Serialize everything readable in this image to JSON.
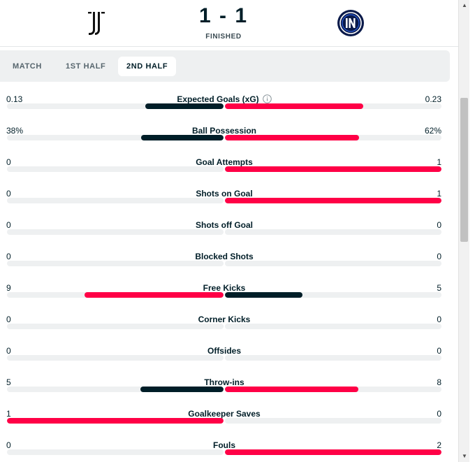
{
  "match": {
    "score": "1 - 1",
    "status": "FINISHED",
    "home_team_icon": "juventus-logo",
    "away_team_icon": "inter-logo"
  },
  "tabs": [
    {
      "label": "MATCH",
      "active": false
    },
    {
      "label": "1ST HALF",
      "active": false
    },
    {
      "label": "2ND HALF",
      "active": true
    }
  ],
  "colors": {
    "leader": "#ff0046",
    "trailer": "#001e28",
    "track": "#eef0f1"
  },
  "stats": [
    {
      "name": "Expected Goals (xG)",
      "home": "0.13",
      "away": "0.23",
      "home_val": 0.13,
      "away_val": 0.23,
      "info_icon": true
    },
    {
      "name": "Ball Possession",
      "home": "38%",
      "away": "62%",
      "home_val": 38,
      "away_val": 62
    },
    {
      "name": "Goal Attempts",
      "home": "0",
      "away": "1",
      "home_val": 0,
      "away_val": 1
    },
    {
      "name": "Shots on Goal",
      "home": "0",
      "away": "1",
      "home_val": 0,
      "away_val": 1
    },
    {
      "name": "Shots off Goal",
      "home": "0",
      "away": "0",
      "home_val": 0,
      "away_val": 0
    },
    {
      "name": "Blocked Shots",
      "home": "0",
      "away": "0",
      "home_val": 0,
      "away_val": 0
    },
    {
      "name": "Free Kicks",
      "home": "9",
      "away": "5",
      "home_val": 9,
      "away_val": 5
    },
    {
      "name": "Corner Kicks",
      "home": "0",
      "away": "0",
      "home_val": 0,
      "away_val": 0
    },
    {
      "name": "Offsides",
      "home": "0",
      "away": "0",
      "home_val": 0,
      "away_val": 0
    },
    {
      "name": "Throw-ins",
      "home": "5",
      "away": "8",
      "home_val": 5,
      "away_val": 8
    },
    {
      "name": "Goalkeeper Saves",
      "home": "1",
      "away": "0",
      "home_val": 1,
      "away_val": 0
    },
    {
      "name": "Fouls",
      "home": "0",
      "away": "2",
      "home_val": 0,
      "away_val": 2
    }
  ]
}
